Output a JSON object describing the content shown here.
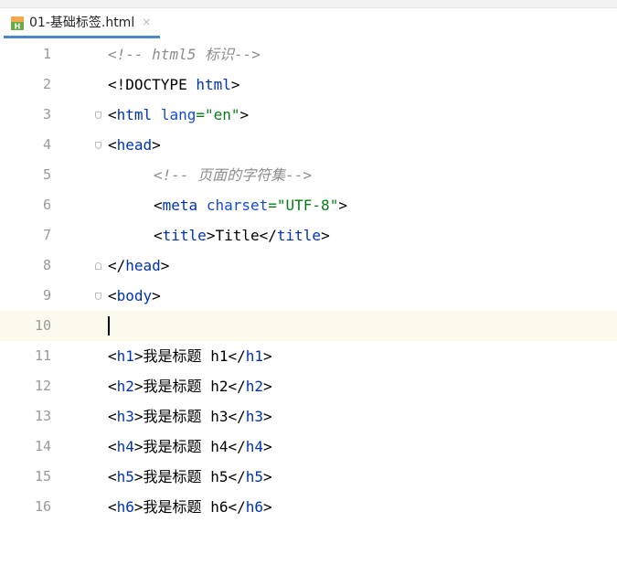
{
  "tab": {
    "label": "01-基础标签.html",
    "close": "×",
    "file_icon": "html-file-icon"
  },
  "lines": [
    {
      "n": "1",
      "text": "<!-- html5 标识-->"
    },
    {
      "n": "2",
      "text": "<!DOCTYPE html>"
    },
    {
      "n": "3",
      "text": "<html lang=\"en\">"
    },
    {
      "n": "4",
      "text": "<head>"
    },
    {
      "n": "5",
      "text": "<!-- 页面的字符集-->"
    },
    {
      "n": "6",
      "text": "<meta charset=\"UTF-8\">"
    },
    {
      "n": "7",
      "text": "<title>Title</title>"
    },
    {
      "n": "8",
      "text": "</head>"
    },
    {
      "n": "9",
      "text": "<body>"
    },
    {
      "n": "10",
      "text": ""
    },
    {
      "n": "11",
      "text": "<h1>我是标题 h1</h1>"
    },
    {
      "n": "12",
      "text": "<h2>我是标题 h2</h2>"
    },
    {
      "n": "13",
      "text": "<h3>我是标题 h3</h3>"
    },
    {
      "n": "14",
      "text": "<h4>我是标题 h4</h4>"
    },
    {
      "n": "15",
      "text": "<h5>我是标题 h5</h5>"
    },
    {
      "n": "16",
      "text": "<h6>我是标题 h6</h6>"
    }
  ],
  "tokens": {
    "l1": {
      "open": "<!-- ",
      "word": "html5 ",
      "cn": "标识",
      "close": "-->"
    },
    "l2": {
      "a": "<!DOCTYPE ",
      "b": "html",
      "c": ">"
    },
    "l3": {
      "a": "<",
      "b": "html",
      "c": " ",
      "d": "lang",
      "e": "=",
      "f": "\"en\"",
      "g": ">"
    },
    "l4": {
      "a": "<",
      "b": "head",
      "c": ">"
    },
    "l5": {
      "open": "<!-- ",
      "cn": "页面的字符集",
      "close": "-->"
    },
    "l6": {
      "a": "<",
      "b": "meta",
      "c": " ",
      "d": "charset",
      "e": "=",
      "f": "\"UTF-8\"",
      "g": ">"
    },
    "l7": {
      "a": "<",
      "b": "title",
      "c": ">",
      "d": "Title",
      "e": "</",
      "f": "title",
      "g": ">"
    },
    "l8": {
      "a": "</",
      "b": "head",
      "c": ">"
    },
    "l9": {
      "a": "<",
      "b": "body",
      "c": ">"
    },
    "h1": {
      "a": "<",
      "b": "h1",
      "c": ">",
      "cn": "我是标题",
      "d": " h1",
      "e": "</",
      "f": "h1",
      "g": ">"
    },
    "h2": {
      "a": "<",
      "b": "h2",
      "c": ">",
      "cn": "我是标题",
      "d": " h2",
      "e": "</",
      "f": "h2",
      "g": ">"
    },
    "h3": {
      "a": "<",
      "b": "h3",
      "c": ">",
      "cn": "我是标题",
      "d": " h3",
      "e": "</",
      "f": "h3",
      "g": ">"
    },
    "h4": {
      "a": "<",
      "b": "h4",
      "c": ">",
      "cn": "我是标题",
      "d": " h4",
      "e": "</",
      "f": "h4",
      "g": ">"
    },
    "h5": {
      "a": "<",
      "b": "h5",
      "c": ">",
      "cn": "我是标题",
      "d": " h5",
      "e": "</",
      "f": "h5",
      "g": ">"
    },
    "h6": {
      "a": "<",
      "b": "h6",
      "c": ">",
      "cn": "我是标题",
      "d": " h6",
      "e": "</",
      "f": "h6",
      "g": ">"
    }
  },
  "colors": {
    "tag": "#0033b3",
    "attr": "#174ad4",
    "string": "#067d17",
    "comment": "#8c8c8c",
    "line_number": "#999999",
    "current_line": "#fcfaed",
    "tab_underline": "#4a88c7"
  }
}
